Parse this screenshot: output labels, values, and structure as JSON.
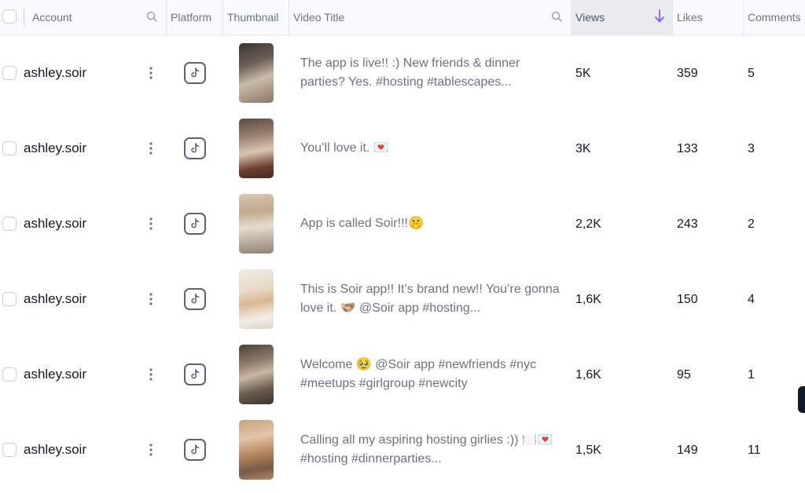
{
  "header": {
    "account": "Account",
    "platform": "Platform",
    "thumbnail": "Thumbnail",
    "video_title": "Video Title",
    "views": "Views",
    "likes": "Likes",
    "comments": "Comments"
  },
  "colors": {
    "sort_arrow": "#8b5cf6",
    "tiktok_icon": "#5b6270"
  },
  "icons": {
    "search": "search-icon",
    "sort": "arrow-down-icon",
    "platform": "tiktok-icon",
    "menu": "kebab-menu-icon"
  },
  "rows": [
    {
      "account": "ashley.soir",
      "title": "The app is live!! :) New friends & dinner parties? Yes. #hosting #tablescapes...",
      "views": "5K",
      "likes": "359",
      "comments": "5"
    },
    {
      "account": "ashley.soir",
      "title": "You’ll love it. 💌",
      "views": "3K",
      "likes": "133",
      "comments": "3"
    },
    {
      "account": "ashley.soir",
      "title": "App is called Soir!!!🤫",
      "views": "2,2K",
      "likes": "243",
      "comments": "2"
    },
    {
      "account": "ashley.soir",
      "title": "This is Soir app!! It’s brand new!! You’re gonna love it. 🫱🏼‍🫲🏽 @Soir app #hosting...",
      "views": "1,6K",
      "likes": "150",
      "comments": "4"
    },
    {
      "account": "ashley.soir",
      "title": "Welcome 🥹 @Soir app #newfriends #nyc #meetups #girlgroup #newcity",
      "views": "1,6K",
      "likes": "95",
      "comments": "1"
    },
    {
      "account": "ashley.soir",
      "title": "Calling all my aspiring hosting girlies :)) 🍽️💌 #hosting #dinnerparties...",
      "views": "1,5K",
      "likes": "149",
      "comments": "11"
    }
  ]
}
